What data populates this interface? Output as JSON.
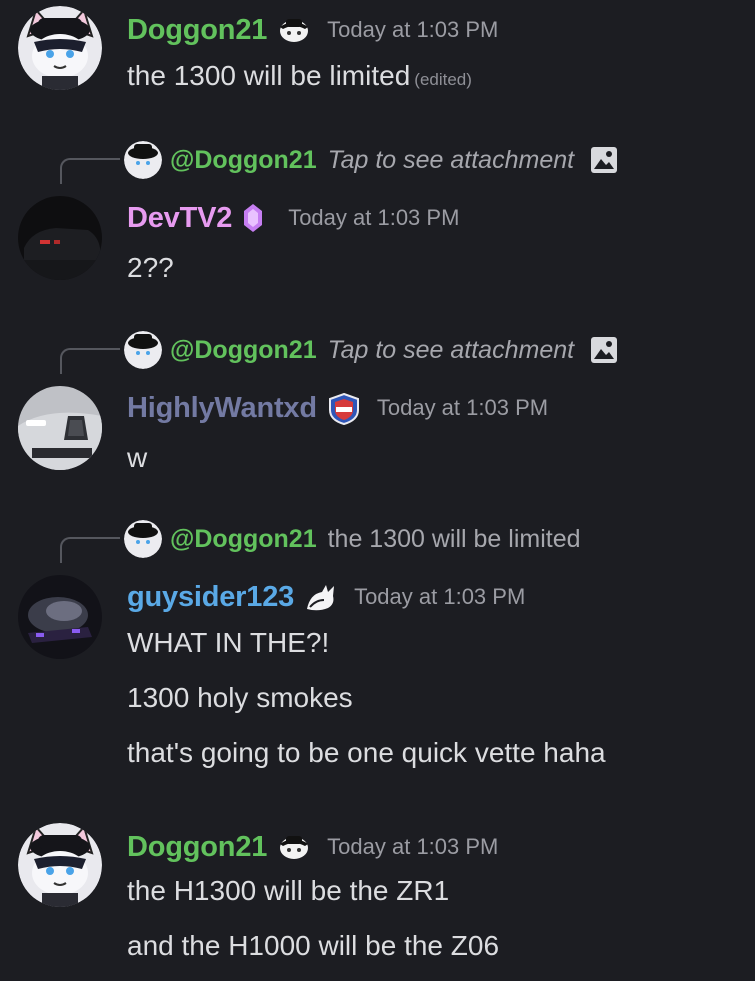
{
  "colors": {
    "background": "#1c1d22",
    "doggon_name": "#62c25d",
    "devtv_name": "#e79bf0",
    "highly_name": "#737aa3",
    "guysider_name": "#5aa9e6",
    "mention": "#62c25d",
    "timestamp": "#9b9ca3"
  },
  "messages": [
    {
      "username": "Doggon21",
      "timestamp": "Today at 1:03 PM",
      "badge_icon": "fedora-dog-icon",
      "lines": [
        "the 1300 will be limited"
      ],
      "edited_label": "(edited)"
    },
    {
      "reply": {
        "mention": "@Doggon21",
        "text": "Tap to see attachment",
        "icon": "image-icon"
      },
      "username": "DevTV2",
      "timestamp": "Today at 1:03 PM",
      "badge_icon": "purple-gem-icon",
      "lines": [
        "2??"
      ]
    },
    {
      "reply": {
        "mention": "@Doggon21",
        "text": "Tap to see attachment",
        "icon": "image-icon"
      },
      "username": "HighlyWantxd",
      "timestamp": "Today at 1:03 PM",
      "badge_icon": "shield-badge-icon",
      "lines": [
        "w"
      ]
    },
    {
      "reply": {
        "mention": "@Doggon21",
        "text": "the 1300 will be limited"
      },
      "username": "guysider123",
      "timestamp": "Today at 1:03 PM",
      "badge_icon": "white-cat-icon",
      "lines": [
        "WHAT IN THE?!",
        "1300 holy smokes",
        "that's going to be one quick vette haha"
      ]
    },
    {
      "username": "Doggon21",
      "timestamp": "Today at 1:03 PM",
      "badge_icon": "fedora-dog-icon",
      "lines": [
        "the H1300 will be the ZR1",
        "and the H1000 will be the Z06"
      ]
    }
  ]
}
